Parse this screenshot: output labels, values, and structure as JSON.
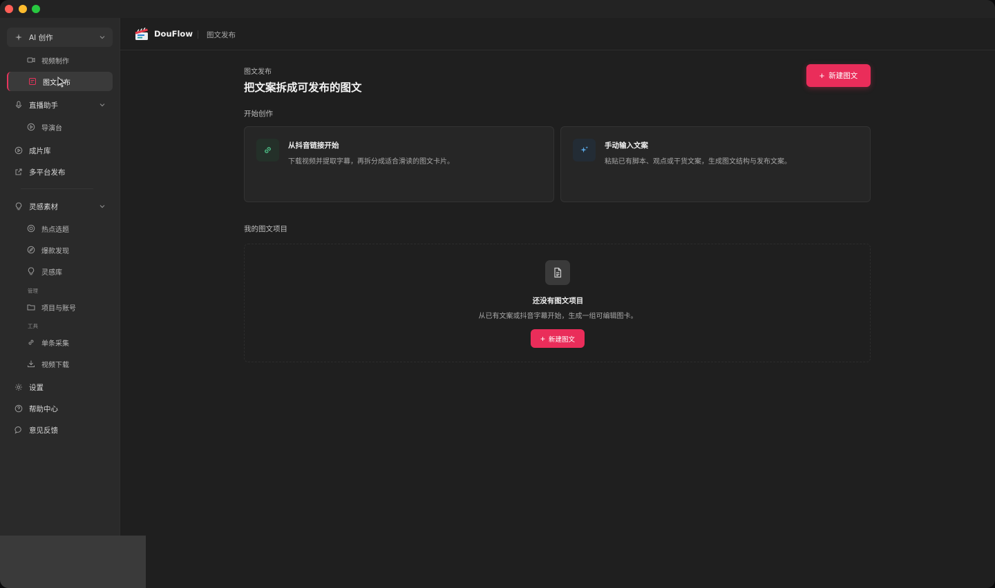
{
  "app": {
    "name": "DouFlow",
    "breadcrumb": "图文发布"
  },
  "sidebar": {
    "groups": [
      {
        "label": "AI 创作",
        "icon": "sparkle-icon"
      },
      {
        "label": "视频制作",
        "icon": "video-camera-icon"
      },
      {
        "label": "图文发布",
        "icon": "image-text-icon"
      },
      {
        "label": "直播助手",
        "icon": "microphone-icon"
      },
      {
        "label": "导演台",
        "icon": "play-circle-icon"
      },
      {
        "label": "成片库",
        "icon": "play-circle-icon"
      },
      {
        "label": "多平台发布",
        "icon": "external-link-icon"
      },
      {
        "label": "灵感素材",
        "icon": "lightbulb-icon"
      },
      {
        "label": "热点选题",
        "icon": "target-icon"
      },
      {
        "label": "爆款发现",
        "icon": "compass-icon"
      },
      {
        "label": "灵感库",
        "icon": "lightbulb-icon"
      },
      {
        "label": "项目与账号",
        "icon": "folder-icon"
      },
      {
        "label": "单条采集",
        "icon": "link-icon"
      },
      {
        "label": "视频下载",
        "icon": "download-icon"
      },
      {
        "label": "设置",
        "icon": "gear-icon"
      },
      {
        "label": "帮助中心",
        "icon": "help-circle-icon"
      },
      {
        "label": "意见反馈",
        "icon": "chat-bubble-icon"
      }
    ],
    "section_manage": "管理",
    "section_tools": "工具"
  },
  "main": {
    "eyebrow": "图文发布",
    "title": "把文案拆成可发布的图文",
    "new_button": "新建图文",
    "start_section": "开始创作",
    "cards": [
      {
        "title": "从抖音链接开始",
        "desc": "下载视频并提取字幕，再拆分成适合滑读的图文卡片。",
        "icon": "link-icon"
      },
      {
        "title": "手动输入文案",
        "desc": "粘贴已有脚本、观点或干货文案，生成图文结构与发布文案。",
        "icon": "sparkle-icon"
      }
    ],
    "projects_section": "我的图文项目",
    "empty": {
      "title": "还没有图文项目",
      "desc": "从已有文案或抖音字幕开始，生成一组可编辑图卡。",
      "button": "新建图文",
      "icon": "document-icon"
    }
  },
  "colors": {
    "accent": "#ea2d5a",
    "background": "#1f1f1f",
    "sidebar": "#2a2a2a"
  }
}
